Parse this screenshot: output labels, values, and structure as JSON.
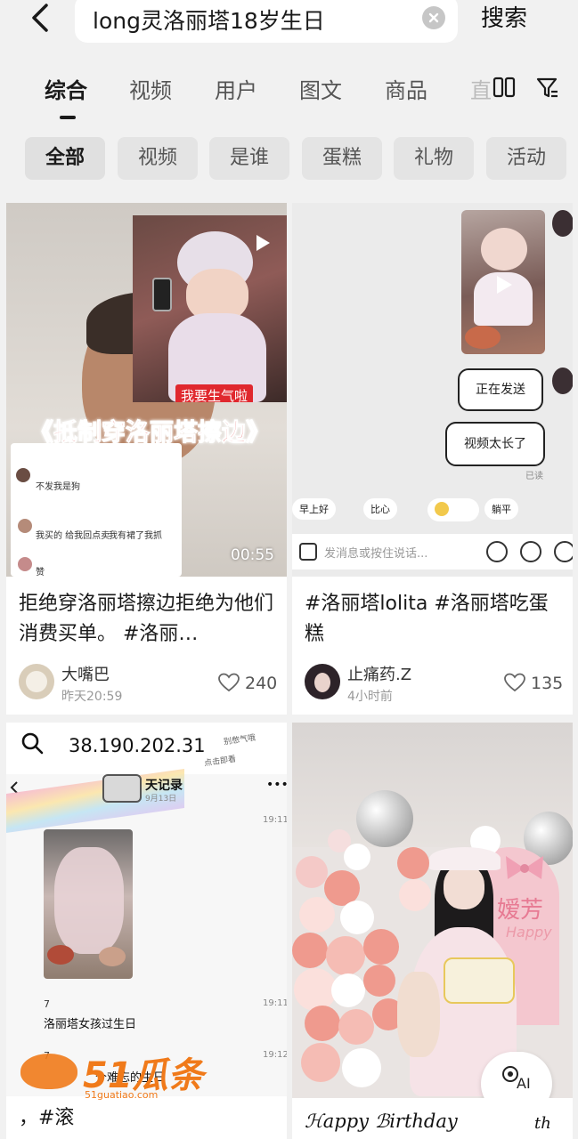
{
  "search": {
    "query": "long灵洛丽塔18岁生日",
    "button_label": "搜索"
  },
  "tabs": [
    {
      "label": "综合"
    },
    {
      "label": "视频"
    },
    {
      "label": "用户"
    },
    {
      "label": "图文"
    },
    {
      "label": "商品"
    },
    {
      "label": "直"
    }
  ],
  "chips": [
    {
      "label": "全部"
    },
    {
      "label": "视频"
    },
    {
      "label": "是谁"
    },
    {
      "label": "蛋糕"
    },
    {
      "label": "礼物"
    },
    {
      "label": "活动"
    }
  ],
  "cards": [
    {
      "title": "拒绝穿洛丽塔擦边拒绝为他们消费买单。 #洛丽…",
      "author": "大嘴巴",
      "time": "昨天20:59",
      "likes": "240",
      "overlay": {
        "banner": "《抵制穿洛丽塔擦边》",
        "sticker": "我要生气啦",
        "duration": "00:55",
        "comments": [
          "不发我是狗",
          "我买的 给我回点卖",
          "我有裙了我抓",
          "赞"
        ]
      }
    },
    {
      "title": "#洛丽塔lolita #洛丽塔吃蛋糕",
      "author": "止痛药.Z",
      "time": "4小时前",
      "likes": "135",
      "overlay": {
        "bubble1": "正在发送",
        "bubble2": "视频太长了",
        "read": "已读",
        "quick_replies": [
          "早上好",
          "比心",
          "",
          "躺平"
        ],
        "input_placeholder": "发消息或按住说话..."
      }
    },
    {
      "title": "，#滚",
      "overlay": {
        "ip": "38.190.202.31",
        "side_note_1": "别憋气哦",
        "side_note_2": "点击即看",
        "chat_title": "天记录",
        "chat_date": "9月13日",
        "time_1": "19:11",
        "num_1": "7",
        "time_2": "19:11",
        "msg_2": "洛丽塔女孩过生日",
        "num_2": "7",
        "time_3": "19:12",
        "msg_3": "个难忘的生日",
        "watermark_brand": "51瓜条",
        "watermark_url": "51guatiao.com"
      }
    },
    {
      "title": "",
      "overlay": {
        "arch_text": "嫒芳",
        "arch_sub": "Happy",
        "caption": "ℋappy ℬirthday",
        "caption_tail": "th",
        "ai_label": "AI"
      }
    }
  ],
  "colors": {
    "accent_red": "#e0282e",
    "banner_red": "#d61e1e",
    "watermark_orange": "#f07a1a",
    "balloon_pink": "#ef9a8e"
  }
}
